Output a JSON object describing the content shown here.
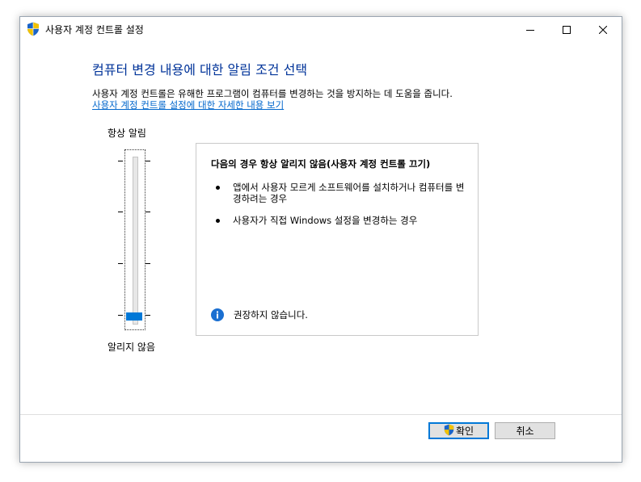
{
  "window": {
    "title": "사용자 계정 컨트롤 설정",
    "shield_icon": "uac-shield-icon"
  },
  "titlebar_buttons": {
    "minimize_icon": "minimize-icon",
    "maximize_icon": "maximize-icon",
    "close_icon": "close-icon"
  },
  "main": {
    "heading": "컴퓨터 변경 내용에 대한 알림 조건 선택",
    "description": "사용자 계정 컨트롤은 유해한 프로그램이 컴퓨터를 변경하는 것을 방지하는 데 도움을 줍니다.",
    "details_link": "사용자 계정 컨트롤 설정에 대한 자세한 내용 보기"
  },
  "slider": {
    "top_label": "항상 알림",
    "bottom_label": "알리지 않음",
    "levels": 4,
    "selected_level": 1
  },
  "panel": {
    "title": "다음의 경우 항상 알리지 않음(사용자 계정 컨트롤 끄기)",
    "bullets": [
      "앱에서 사용자 모르게 소프트웨어를 설치하거나 컴퓨터를 변경하려는 경우",
      "사용자가 직접 Windows 설정을 변경하는 경우"
    ],
    "info_icon": "info-icon",
    "recommendation": "권장하지 않습니다."
  },
  "buttons": {
    "ok_label": "확인",
    "cancel_label": "취소"
  },
  "colors": {
    "accent": "#0078d7",
    "heading": "#003399",
    "link": "#0066cc"
  }
}
